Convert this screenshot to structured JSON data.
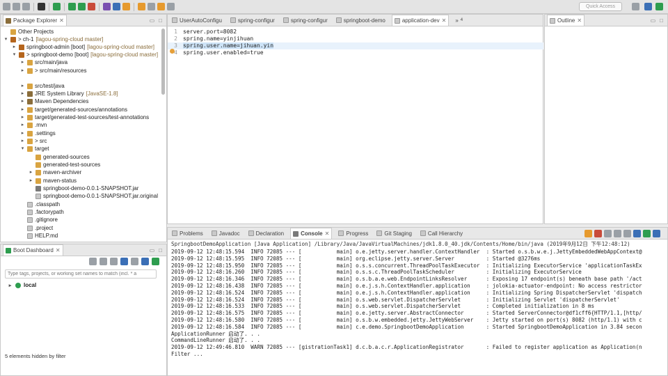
{
  "toolbar": {
    "quick_access": "Quick Access"
  },
  "package_explorer": {
    "title": "Package Explorer",
    "tree": [
      {
        "label": "Other Projects",
        "decoration": "",
        "twist": "",
        "icon": "folder"
      },
      {
        "label": "> ch-1",
        "decoration": "[lagou-spring-cloud master]",
        "twist": "▾",
        "icon": "proj"
      },
      {
        "label": "springboot-admin [boot]",
        "decoration": "[lagou-spring-cloud master]",
        "twist": "▸",
        "icon": "proj"
      },
      {
        "label": "> springboot-demo [boot]",
        "decoration": "[lagou-spring-cloud master]",
        "twist": "▾",
        "icon": "proj"
      },
      {
        "label": "src/main/java",
        "decoration": "",
        "twist": "▸",
        "icon": "folder"
      },
      {
        "label": "> src/main/resources",
        "decoration": "",
        "twist": "▸",
        "icon": "folder"
      },
      {
        "label": "src/test/java",
        "decoration": "",
        "twist": "▸",
        "icon": "folder"
      },
      {
        "label": "JRE System Library",
        "decoration": "[JavaSE-1.8]",
        "twist": "▸",
        "icon": "jlib"
      },
      {
        "label": "Maven Dependencies",
        "decoration": "",
        "twist": "▸",
        "icon": "jlib"
      },
      {
        "label": "target/generated-sources/annotations",
        "decoration": "",
        "twist": "▸",
        "icon": "folder"
      },
      {
        "label": "target/generated-test-sources/test-annotations",
        "decoration": "",
        "twist": "▸",
        "icon": "folder"
      },
      {
        "label": ".mvn",
        "decoration": "",
        "twist": "▸",
        "icon": "folder"
      },
      {
        "label": ".settings",
        "decoration": "",
        "twist": "▸",
        "icon": "folder"
      },
      {
        "label": "> src",
        "decoration": "",
        "twist": "▸",
        "icon": "folder"
      },
      {
        "label": "target",
        "decoration": "",
        "twist": "▾",
        "icon": "folder"
      },
      {
        "label": "generated-sources",
        "decoration": "",
        "twist": "",
        "icon": "folder"
      },
      {
        "label": "generated-test-sources",
        "decoration": "",
        "twist": "",
        "icon": "folder"
      },
      {
        "label": "maven-archiver",
        "decoration": "",
        "twist": "▸",
        "icon": "folder"
      },
      {
        "label": "maven-status",
        "decoration": "",
        "twist": "▸",
        "icon": "folder"
      },
      {
        "label": "springboot-demo-0.0.1-SNAPSHOT.jar",
        "decoration": "",
        "twist": "",
        "icon": "jar"
      },
      {
        "label": "springboot-demo-0.0.1-SNAPSHOT.jar.original",
        "decoration": "",
        "twist": "",
        "icon": "file"
      },
      {
        "label": ".classpath",
        "decoration": "",
        "twist": "",
        "icon": "file"
      },
      {
        "label": ".factorypath",
        "decoration": "",
        "twist": "",
        "icon": "file"
      },
      {
        "label": ".gitignore",
        "decoration": "",
        "twist": "",
        "icon": "file"
      },
      {
        "label": ".project",
        "decoration": "",
        "twist": "",
        "icon": "file"
      },
      {
        "label": "HELP.md",
        "decoration": "",
        "twist": "",
        "icon": "file"
      }
    ]
  },
  "boot_dashboard": {
    "title": "Boot Dashboard",
    "filter_placeholder": "Type tags, projects, or working set names to match (incl. * a",
    "local_label": "local",
    "footer": "5 elements hidden by filter"
  },
  "editor": {
    "tabs": [
      {
        "label": "UserAutoConfigu",
        "active": false
      },
      {
        "label": "spring-configur",
        "active": false
      },
      {
        "label": "spring-configur",
        "active": false
      },
      {
        "label": "springboot-demo",
        "active": false
      },
      {
        "label": "application-dev",
        "active": true
      },
      {
        "label": "»",
        "active": false
      }
    ],
    "overflow_count": "4",
    "lines": [
      {
        "num": "1",
        "text": "server.port=8082"
      },
      {
        "num": "2",
        "text": "spring.name=yinjihuan"
      },
      {
        "num": "3",
        "text": "spring.user.name=jihuan.yin"
      },
      {
        "num": "4",
        "text": "spring.user.enabled=true"
      }
    ]
  },
  "outline": {
    "title": "Outline"
  },
  "console": {
    "tabs": [
      {
        "label": "Problems",
        "active": false
      },
      {
        "label": "Javadoc",
        "active": false
      },
      {
        "label": "Declaration",
        "active": false
      },
      {
        "label": "Console",
        "active": true
      },
      {
        "label": "Progress",
        "active": false
      },
      {
        "label": "Git Staging",
        "active": false
      },
      {
        "label": "Call Hierarchy",
        "active": false
      }
    ],
    "header": "SpringbootDemoApplication [Java Application] /Library/Java/JavaVirtualMachines/jdk1.8.0_40.jdk/Contents/Home/bin/java (2019年9月12日 下午12:48:12)",
    "lines": [
      "2019-09-12 12:48:15.594  INFO 72085 --- [           main] o.e.jetty.server.handler.ContextHandler  : Started o.s.b.w.e.j.JettyEmbeddedWebAppContext@",
      "2019-09-12 12:48:15.595  INFO 72085 --- [           main] org.eclipse.jetty.server.Server          : Started @3276ms",
      "2019-09-12 12:48:15.950  INFO 72085 --- [           main] o.s.s.concurrent.ThreadPoolTaskExecutor  : Initializing ExecutorService 'applicationTaskEx",
      "2019-09-12 12:48:16.260  INFO 72085 --- [           main] o.s.s.c.ThreadPoolTaskScheduler          : Initializing ExecutorService",
      "2019-09-12 12:48:16.346  INFO 72085 --- [           main] o.s.b.a.e.web.EndpointLinksResolver      : Exposing 17 endpoint(s) beneath base path '/act",
      "2019-09-12 12:48:16.438  INFO 72085 --- [           main] o.e.j.s.h.ContextHandler.application     : jolokia-actuator-endpoint: No access restrictor",
      "2019-09-12 12:48:16.524  INFO 72085 --- [           main] o.e.j.s.h.ContextHandler.application     : Initializing Spring DispatcherServlet 'dispatch",
      "2019-09-12 12:48:16.524  INFO 72085 --- [           main] o.s.web.servlet.DispatcherServlet        : Initializing Servlet 'dispatcherServlet'",
      "2019-09-12 12:48:16.533  INFO 72085 --- [           main] o.s.web.servlet.DispatcherServlet        : Completed initialization in 8 ms",
      "2019-09-12 12:48:16.575  INFO 72085 --- [           main] o.e.jetty.server.AbstractConnector       : Started ServerConnector@df1cff6{HTTP/1.1,[http/",
      "2019-09-12 12:48:16.580  INFO 72085 --- [           main] o.s.b.w.embedded.jetty.JettyWebServer    : Jetty started on port(s) 8082 (http/1.1) with c",
      "2019-09-12 12:48:16.584  INFO 72085 --- [           main] c.e.demo.SpringbootDemoApplication       : Started SpringbootDemoApplication in 3.84 secon",
      "ApplicationRunner 启动了. . .",
      "CommandLineRunner 启动了. . .",
      "2019-09-12 12:49:46.810  WARN 72085 --- [gistrationTask1] d.c.b.a.c.r.ApplicationRegistrator       : Failed to register application as Application(n",
      "Filter ..."
    ]
  }
}
